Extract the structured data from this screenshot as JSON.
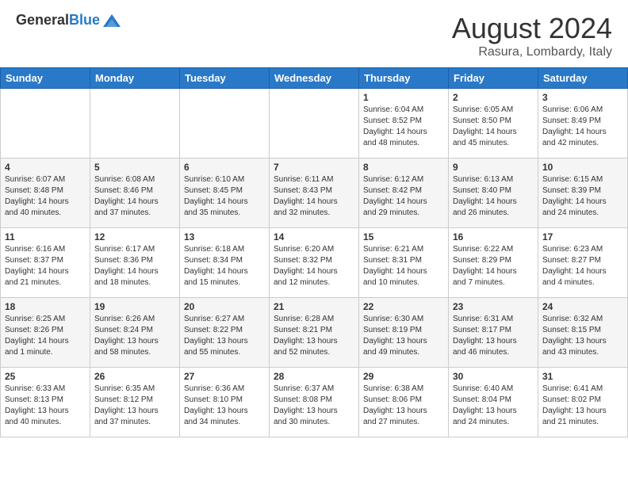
{
  "header": {
    "logo_general": "General",
    "logo_blue": "Blue",
    "month_year": "August 2024",
    "location": "Rasura, Lombardy, Italy"
  },
  "days_of_week": [
    "Sunday",
    "Monday",
    "Tuesday",
    "Wednesday",
    "Thursday",
    "Friday",
    "Saturday"
  ],
  "weeks": [
    [
      {
        "day": "",
        "info": ""
      },
      {
        "day": "",
        "info": ""
      },
      {
        "day": "",
        "info": ""
      },
      {
        "day": "",
        "info": ""
      },
      {
        "day": "1",
        "info": "Sunrise: 6:04 AM\nSunset: 8:52 PM\nDaylight: 14 hours\nand 48 minutes."
      },
      {
        "day": "2",
        "info": "Sunrise: 6:05 AM\nSunset: 8:50 PM\nDaylight: 14 hours\nand 45 minutes."
      },
      {
        "day": "3",
        "info": "Sunrise: 6:06 AM\nSunset: 8:49 PM\nDaylight: 14 hours\nand 42 minutes."
      }
    ],
    [
      {
        "day": "4",
        "info": "Sunrise: 6:07 AM\nSunset: 8:48 PM\nDaylight: 14 hours\nand 40 minutes."
      },
      {
        "day": "5",
        "info": "Sunrise: 6:08 AM\nSunset: 8:46 PM\nDaylight: 14 hours\nand 37 minutes."
      },
      {
        "day": "6",
        "info": "Sunrise: 6:10 AM\nSunset: 8:45 PM\nDaylight: 14 hours\nand 35 minutes."
      },
      {
        "day": "7",
        "info": "Sunrise: 6:11 AM\nSunset: 8:43 PM\nDaylight: 14 hours\nand 32 minutes."
      },
      {
        "day": "8",
        "info": "Sunrise: 6:12 AM\nSunset: 8:42 PM\nDaylight: 14 hours\nand 29 minutes."
      },
      {
        "day": "9",
        "info": "Sunrise: 6:13 AM\nSunset: 8:40 PM\nDaylight: 14 hours\nand 26 minutes."
      },
      {
        "day": "10",
        "info": "Sunrise: 6:15 AM\nSunset: 8:39 PM\nDaylight: 14 hours\nand 24 minutes."
      }
    ],
    [
      {
        "day": "11",
        "info": "Sunrise: 6:16 AM\nSunset: 8:37 PM\nDaylight: 14 hours\nand 21 minutes."
      },
      {
        "day": "12",
        "info": "Sunrise: 6:17 AM\nSunset: 8:36 PM\nDaylight: 14 hours\nand 18 minutes."
      },
      {
        "day": "13",
        "info": "Sunrise: 6:18 AM\nSunset: 8:34 PM\nDaylight: 14 hours\nand 15 minutes."
      },
      {
        "day": "14",
        "info": "Sunrise: 6:20 AM\nSunset: 8:32 PM\nDaylight: 14 hours\nand 12 minutes."
      },
      {
        "day": "15",
        "info": "Sunrise: 6:21 AM\nSunset: 8:31 PM\nDaylight: 14 hours\nand 10 minutes."
      },
      {
        "day": "16",
        "info": "Sunrise: 6:22 AM\nSunset: 8:29 PM\nDaylight: 14 hours\nand 7 minutes."
      },
      {
        "day": "17",
        "info": "Sunrise: 6:23 AM\nSunset: 8:27 PM\nDaylight: 14 hours\nand 4 minutes."
      }
    ],
    [
      {
        "day": "18",
        "info": "Sunrise: 6:25 AM\nSunset: 8:26 PM\nDaylight: 14 hours\nand 1 minute."
      },
      {
        "day": "19",
        "info": "Sunrise: 6:26 AM\nSunset: 8:24 PM\nDaylight: 13 hours\nand 58 minutes."
      },
      {
        "day": "20",
        "info": "Sunrise: 6:27 AM\nSunset: 8:22 PM\nDaylight: 13 hours\nand 55 minutes."
      },
      {
        "day": "21",
        "info": "Sunrise: 6:28 AM\nSunset: 8:21 PM\nDaylight: 13 hours\nand 52 minutes."
      },
      {
        "day": "22",
        "info": "Sunrise: 6:30 AM\nSunset: 8:19 PM\nDaylight: 13 hours\nand 49 minutes."
      },
      {
        "day": "23",
        "info": "Sunrise: 6:31 AM\nSunset: 8:17 PM\nDaylight: 13 hours\nand 46 minutes."
      },
      {
        "day": "24",
        "info": "Sunrise: 6:32 AM\nSunset: 8:15 PM\nDaylight: 13 hours\nand 43 minutes."
      }
    ],
    [
      {
        "day": "25",
        "info": "Sunrise: 6:33 AM\nSunset: 8:13 PM\nDaylight: 13 hours\nand 40 minutes."
      },
      {
        "day": "26",
        "info": "Sunrise: 6:35 AM\nSunset: 8:12 PM\nDaylight: 13 hours\nand 37 minutes."
      },
      {
        "day": "27",
        "info": "Sunrise: 6:36 AM\nSunset: 8:10 PM\nDaylight: 13 hours\nand 34 minutes."
      },
      {
        "day": "28",
        "info": "Sunrise: 6:37 AM\nSunset: 8:08 PM\nDaylight: 13 hours\nand 30 minutes."
      },
      {
        "day": "29",
        "info": "Sunrise: 6:38 AM\nSunset: 8:06 PM\nDaylight: 13 hours\nand 27 minutes."
      },
      {
        "day": "30",
        "info": "Sunrise: 6:40 AM\nSunset: 8:04 PM\nDaylight: 13 hours\nand 24 minutes."
      },
      {
        "day": "31",
        "info": "Sunrise: 6:41 AM\nSunset: 8:02 PM\nDaylight: 13 hours\nand 21 minutes."
      }
    ]
  ]
}
